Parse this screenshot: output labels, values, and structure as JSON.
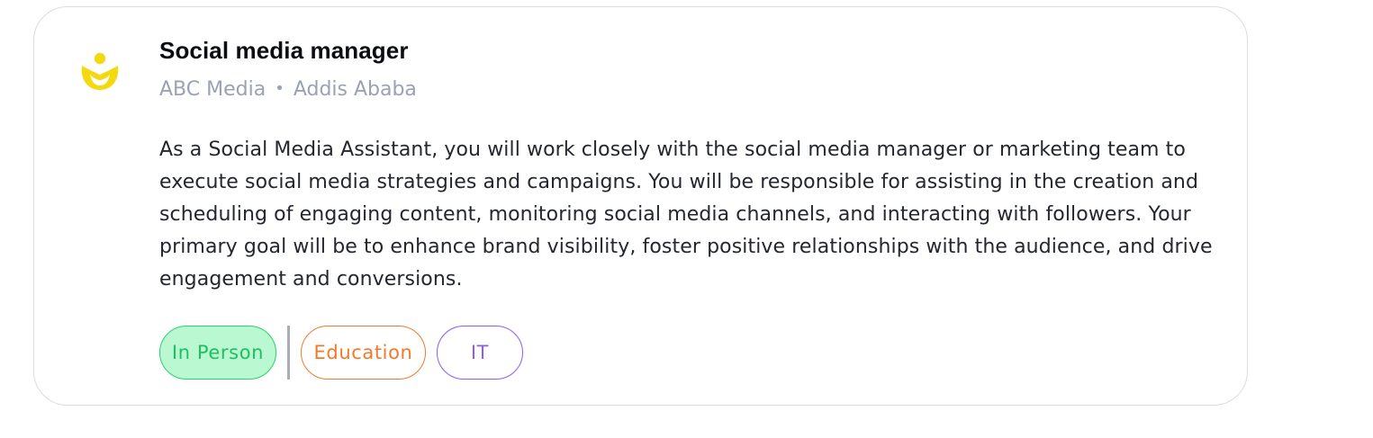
{
  "job": {
    "title": "Social media manager",
    "company": "ABC Media",
    "separator": "•",
    "location": "Addis Ababa",
    "description": "As a Social Media Assistant, you will work closely with the social media manager or marketing team to execute social media strategies and campaigns. You will be responsible for assisting in the creation and scheduling of engaging content, monitoring social media channels, and interacting with followers. Your primary goal will be to enhance brand visibility, foster positive relationships with the audience, and drive engagement and conversions.",
    "logo_icon": "company-logo-icon",
    "tags": [
      {
        "label": "In Person",
        "color": "#1fbf63",
        "background": "#b9f8d0"
      },
      {
        "label": "Education",
        "color": "#f07a2c"
      },
      {
        "label": "IT",
        "color": "#8b5cf6"
      }
    ]
  },
  "colors": {
    "logo": "#f5d90f",
    "card_border": "#d6dde6",
    "meta_text": "#9aa2b3"
  }
}
